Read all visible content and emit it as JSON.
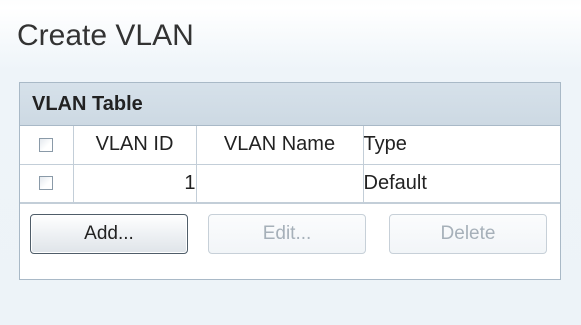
{
  "page": {
    "title": "Create VLAN"
  },
  "vlan_table": {
    "caption": "VLAN Table",
    "columns": [
      "",
      "VLAN ID",
      "VLAN Name",
      "Type"
    ],
    "rows": [
      {
        "checked": false,
        "vlan_id": "1",
        "vlan_name": "",
        "type": "Default"
      }
    ]
  },
  "buttons": {
    "add": {
      "label": "Add...",
      "enabled": true
    },
    "edit": {
      "label": "Edit...",
      "enabled": false
    },
    "delete": {
      "label": "Delete",
      "enabled": false
    }
  },
  "colors": {
    "caption_bg": "#d6e1ea",
    "page_bg": "#edf3f8",
    "disabled_text": "#a6b0b9"
  }
}
